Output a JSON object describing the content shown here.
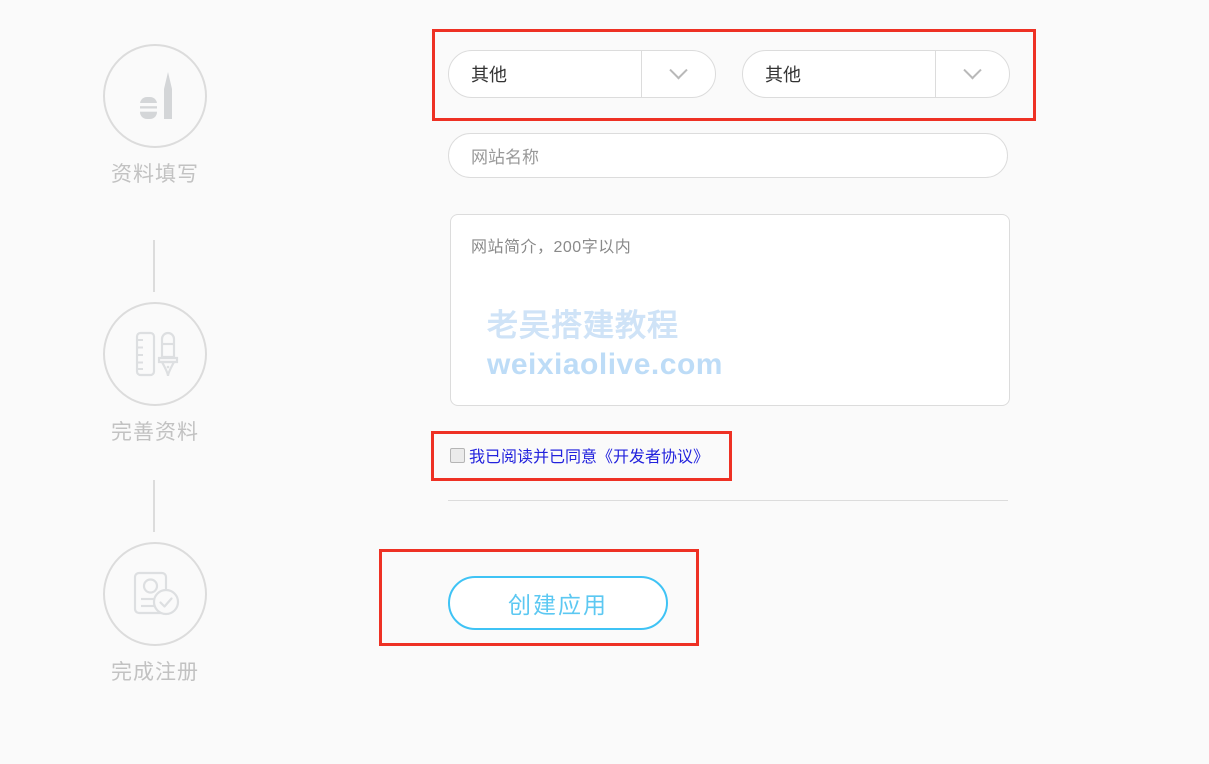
{
  "background_color": "#fafafa",
  "stepper": {
    "steps": [
      {
        "label": "资料填写",
        "icon": "pencil-eraser-icon",
        "state": "inactive"
      },
      {
        "label": "完善资料",
        "icon": "ruler-pen-icon",
        "state": "inactive"
      },
      {
        "label": "完成注册",
        "icon": "id-card-check-icon",
        "state": "inactive"
      }
    ]
  },
  "form": {
    "category_select_1": {
      "value": "其他",
      "icon": "chevron-down-icon"
    },
    "category_select_2": {
      "value": "其他",
      "icon": "chevron-down-icon"
    },
    "site_name": {
      "value": "",
      "placeholder": "网站名称"
    },
    "site_intro": {
      "value": "",
      "placeholder": "网站简介，200字以内"
    },
    "agreement": {
      "checked": false,
      "label": "我已阅读并已同意《开发者协议》",
      "link_color": "#2222dd"
    },
    "submit_button": {
      "label": "创建应用",
      "color": "#5cc8f2"
    }
  },
  "watermark": {
    "line1": "老吴搭建教程",
    "line2": "weixiaolive.com"
  },
  "annotations": {
    "color": "#ee3124",
    "boxes": [
      "select-row",
      "agreement-row",
      "create-button"
    ]
  }
}
